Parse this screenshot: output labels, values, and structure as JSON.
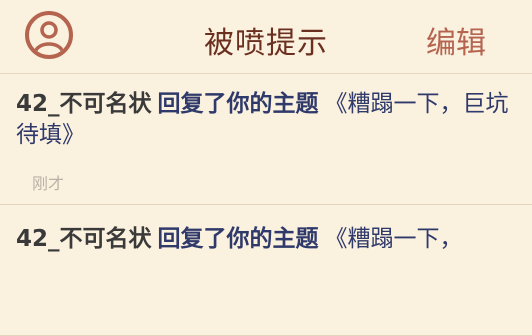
{
  "header": {
    "title": "被喷提示",
    "edit_label": "编辑"
  },
  "notifications": [
    {
      "user": "42_不可名状",
      "action": "回复了你的主题",
      "topic": "《糟蹋一下，巨坑待填》",
      "time": "刚才"
    },
    {
      "user": "42_不可名状",
      "action": "回复了你的主题",
      "topic": "《糟蹋一下，"
    }
  ],
  "colors": {
    "background": "#fbf1df",
    "accent": "#b4644f",
    "title": "#6b2f20",
    "link": "#2f3a6b"
  }
}
